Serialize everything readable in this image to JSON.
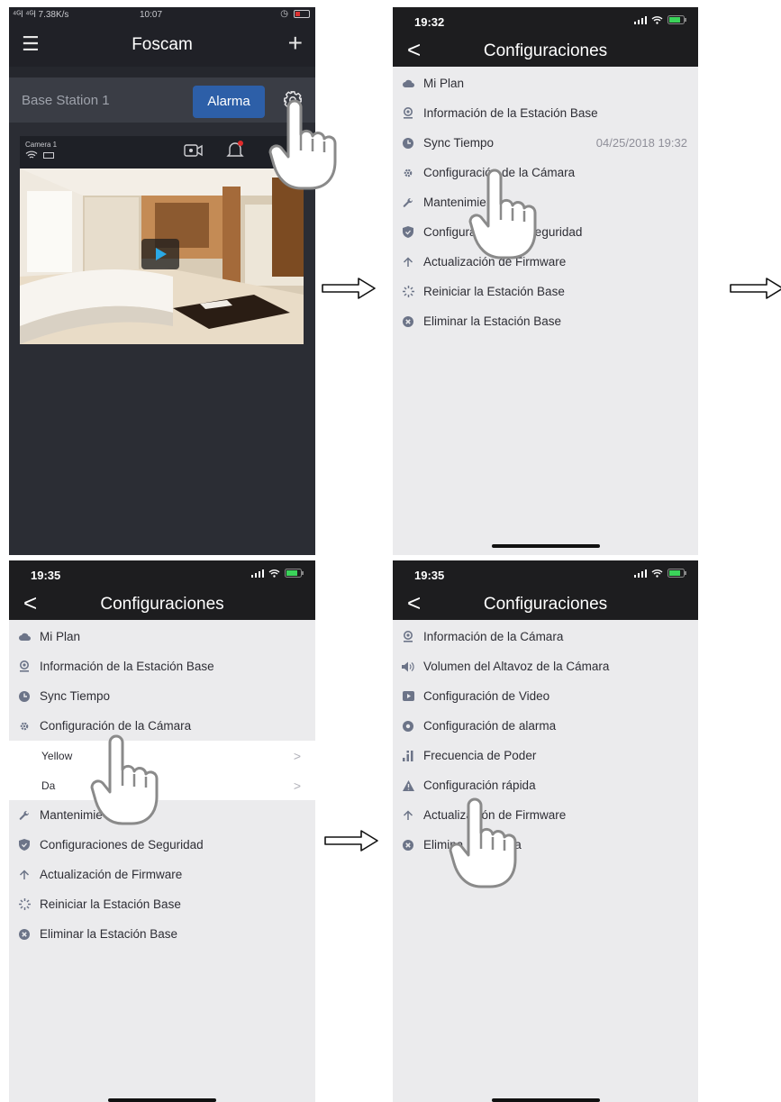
{
  "screen1": {
    "status": {
      "left": "⁴ᴳl ⁴ᴳl 7.38K/s",
      "time": "10:07"
    },
    "app_title": "Foscam",
    "base_station": "Base Station 1",
    "alarm_button": "Alarma",
    "camera_name": "Camera 1"
  },
  "screen2": {
    "time": "19:32",
    "title": "Configuraciones",
    "items": [
      {
        "label": "Mi Plan",
        "icon": "cloud-icon"
      },
      {
        "label": "Información de la Estación Base",
        "icon": "webcam-icon"
      },
      {
        "label": "Sync Tiempo",
        "icon": "clock-icon",
        "value": "04/25/2018 19:32"
      },
      {
        "label": "Configuración de la Cámara",
        "icon": "gear-icon"
      },
      {
        "label": "Mantenimie",
        "icon": "wrench-icon"
      },
      {
        "label": "Configura            e Seguridad",
        "icon": "shield-icon"
      },
      {
        "label": "Actualización de Firmware",
        "icon": "arrow-up-icon"
      },
      {
        "label": "Reiniciar la Estación Base",
        "icon": "spinner-icon"
      },
      {
        "label": "Eliminar la Estación Base",
        "icon": "close-circle-icon"
      }
    ]
  },
  "screen3": {
    "time": "19:35",
    "title": "Configuraciones",
    "items_top": [
      {
        "label": "Mi Plan",
        "icon": "cloud-icon"
      },
      {
        "label": "Información de la Estación Base",
        "icon": "webcam-icon"
      },
      {
        "label": "Sync Tiempo",
        "icon": "clock-icon"
      },
      {
        "label": "Configuración de la Cámara",
        "icon": "gear-icon"
      }
    ],
    "sub_items": [
      {
        "label": "Yellow",
        "chevron": ">"
      },
      {
        "label": "Da",
        "chevron": ">"
      }
    ],
    "items_bottom": [
      {
        "label": "Mantenimie",
        "icon": "wrench-icon"
      },
      {
        "label": "Configuraciones de Seguridad",
        "icon": "shield-icon"
      },
      {
        "label": "Actualización de Firmware",
        "icon": "arrow-up-icon"
      },
      {
        "label": "Reiniciar la Estación Base",
        "icon": "spinner-icon"
      },
      {
        "label": "Eliminar la Estación Base",
        "icon": "close-circle-icon"
      }
    ]
  },
  "screen4": {
    "time": "19:35",
    "title": "Configuraciones",
    "items": [
      {
        "label": "Información de la Cámara",
        "icon": "webcam-icon"
      },
      {
        "label": "Volumen del Altavoz de la Cámara",
        "icon": "speaker-icon"
      },
      {
        "label": "Configuración de Video",
        "icon": "video-icon"
      },
      {
        "label": "Configuración de alarma",
        "icon": "alarm-icon"
      },
      {
        "label": "Frecuencia de Poder",
        "icon": "bars-icon"
      },
      {
        "label": "Configuración rápida",
        "icon": "warning-icon"
      },
      {
        "label": "Actualización de Firmware",
        "icon": "arrow-up-icon"
      },
      {
        "label": "Elimina            ara",
        "icon": "close-circle-icon"
      }
    ]
  },
  "colors": {
    "alarm": "#2d5fa8",
    "list_bg": "#ebebed",
    "dark_bg": "#2b2d34",
    "icon": "#6c7488"
  }
}
